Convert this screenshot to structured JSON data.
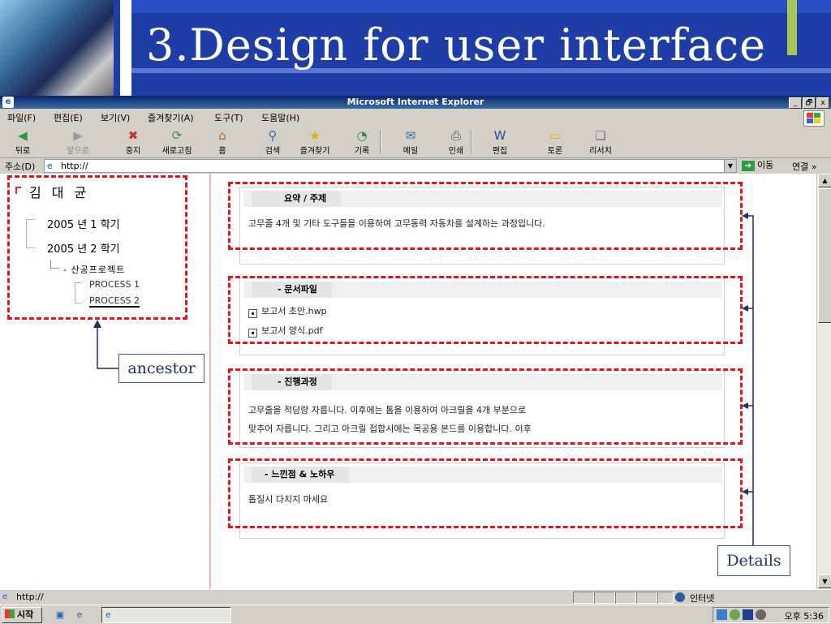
{
  "slide": {
    "title": "3.Design for user interface"
  },
  "window": {
    "title": "Microsoft Internet Explorer",
    "controls": [
      "_",
      "🗗",
      "x"
    ]
  },
  "menubar": {
    "items": [
      "파일(F)",
      "편집(E)",
      "보기(V)",
      "즐겨찾기(A)",
      "도구(T)",
      "도움말(H)"
    ]
  },
  "toolbar": {
    "buttons": [
      {
        "label": "뒤로",
        "icon": "back-arrow-icon",
        "glyph": "◀"
      },
      {
        "label": "앞으로",
        "icon": "forward-arrow-icon",
        "glyph": "▶"
      },
      {
        "label": "중지",
        "icon": "stop-icon",
        "glyph": "✖"
      },
      {
        "label": "새로고침",
        "icon": "refresh-icon",
        "glyph": "⟳"
      },
      {
        "label": "홈",
        "icon": "home-icon",
        "glyph": "⌂"
      },
      {
        "label": "검색",
        "icon": "search-icon",
        "glyph": "⚲"
      },
      {
        "label": "즐겨찾기",
        "icon": "favorites-star-icon",
        "glyph": "★"
      },
      {
        "label": "기록",
        "icon": "history-icon",
        "glyph": "◔"
      },
      {
        "label": "메일",
        "icon": "mail-icon",
        "glyph": "✉"
      },
      {
        "label": "인쇄",
        "icon": "print-icon",
        "glyph": "⎙"
      },
      {
        "label": "편집",
        "icon": "edit-icon",
        "glyph": "W"
      },
      {
        "label": "토론",
        "icon": "discuss-icon",
        "glyph": "▭"
      },
      {
        "label": "리서치",
        "icon": "research-icon",
        "glyph": "❏"
      }
    ]
  },
  "address": {
    "label": "주소(D)",
    "value": "http://",
    "go_label": "이동",
    "links_label": "연결 »"
  },
  "tree": {
    "root": "김 대 균",
    "semesters": [
      "2005 년 1 학기",
      "2005 년 2 학기"
    ],
    "project": "- 산공프로젝트",
    "processes": [
      "PROCESS 1",
      "PROCESS 2"
    ]
  },
  "callouts": {
    "ancestor": "ancestor",
    "details": "Details"
  },
  "panels": [
    {
      "title": "요약 / 주제",
      "lines": [
        "고무줄 4개 및 기타 도구들을 이용하여 고무동력 자동차를 설계하는 과정입니다."
      ]
    },
    {
      "title": "- 문서파일",
      "files": [
        "보고서 초안.hwp",
        "보고서 양식.pdf"
      ]
    },
    {
      "title": "- 진행과정",
      "lines": [
        "고무줄을 적당량 자릅니다. 이후에는 톱을 이용하여 아크릴을 4개 부분으로",
        "맞추어 자릅니다. 그리고 아크릴 접합시에는 목공용 본드를 이용합니다. 이후"
      ]
    },
    {
      "title": "- 느낀점 & 노하우",
      "lines": [
        "톱질시 다치지 마세요"
      ]
    }
  ],
  "statusbar": {
    "text": "http://",
    "zone": "인터넷"
  },
  "taskbar": {
    "start_label": "시작",
    "clock": "오후 5:36"
  },
  "colors": {
    "annotation_red": "#e8141b",
    "callout_blue": "#1f2f70",
    "slide_blue": "#1f3da6"
  }
}
